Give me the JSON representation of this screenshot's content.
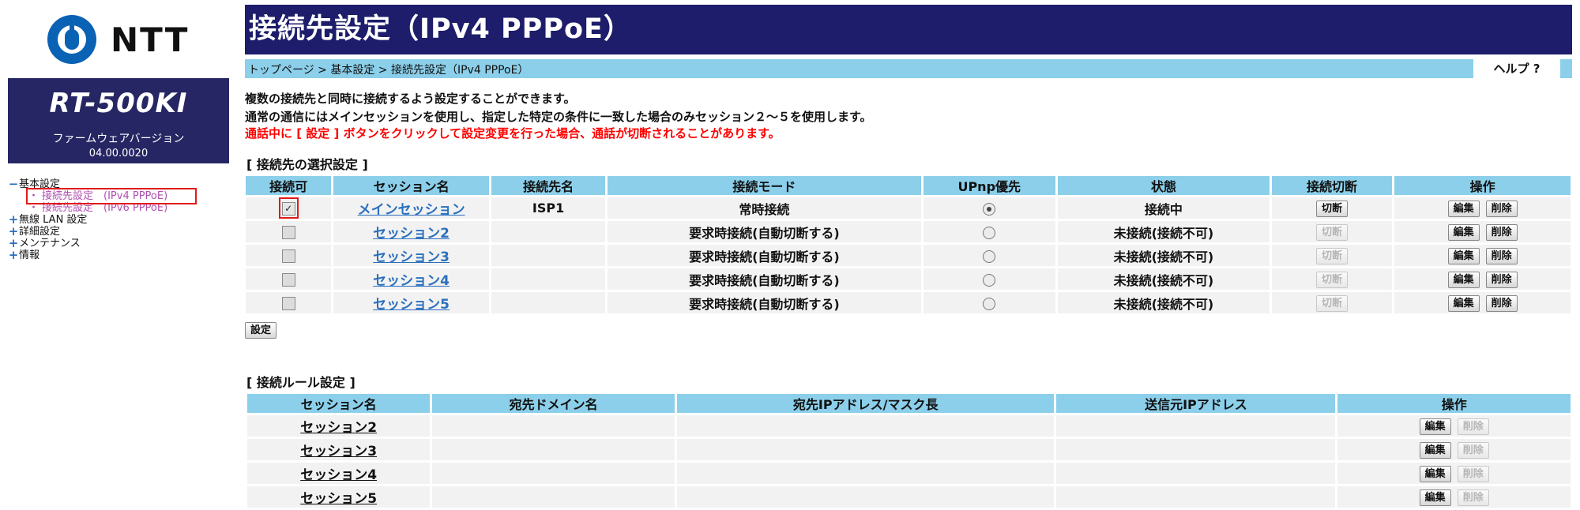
{
  "brand": {
    "logo_text": "NTT",
    "model": "RT-500KI",
    "fw_label": "ファームウェアバージョン",
    "fw_version": "04.00.0020"
  },
  "nav": {
    "basic": "基本設定",
    "sub_ipv4": "接続先設定　(IPv4 PPPoE)",
    "sub_ipv6": "接続先設定　(IPv6 PPPoE)",
    "wlan": "無線 LAN 設定",
    "detail": "詳細設定",
    "maint": "メンテナンス",
    "info": "情報"
  },
  "header": {
    "title": "接続先設定（IPv4 PPPoE）",
    "breadcrumb": "トップページ > 基本設定 > 接続先設定（IPv4 PPPoE）",
    "help": "ヘルプ ?"
  },
  "intro": {
    "line1": "複数の接続先と同時に接続するよう設定することができます。",
    "line2": "通常の通信にはメインセッションを使用し、指定した特定の条件に一致した場合のみセッション２～５を使用します。",
    "line3": "通話中に [ 設定 ] ボタンをクリックして設定変更を行った場合、通話が切断されることがあります。"
  },
  "sessions": {
    "label": "[ 接続先の選択設定 ]",
    "headers": [
      "接続可",
      "セッション名",
      "接続先名",
      "接続モード",
      "UPnp優先",
      "状態",
      "接続切断",
      "操作"
    ],
    "rows": [
      {
        "enabled": true,
        "name": "メインセッション",
        "dest": "ISP1",
        "mode": "常時接続",
        "upnp": true,
        "status": "接続中",
        "disconnect": "切断",
        "edit": "編集",
        "delete": "削除"
      },
      {
        "enabled": false,
        "name": "セッション2",
        "dest": "",
        "mode": "要求時接続(自動切断する)",
        "upnp": false,
        "status": "未接続(接続不可)",
        "disconnect": "切断",
        "edit": "編集",
        "delete": "削除"
      },
      {
        "enabled": false,
        "name": "セッション3",
        "dest": "",
        "mode": "要求時接続(自動切断する)",
        "upnp": false,
        "status": "未接続(接続不可)",
        "disconnect": "切断",
        "edit": "編集",
        "delete": "削除"
      },
      {
        "enabled": false,
        "name": "セッション4",
        "dest": "",
        "mode": "要求時接続(自動切断する)",
        "upnp": false,
        "status": "未接続(接続不可)",
        "disconnect": "切断",
        "edit": "編集",
        "delete": "削除"
      },
      {
        "enabled": false,
        "name": "セッション5",
        "dest": "",
        "mode": "要求時接続(自動切断する)",
        "upnp": false,
        "status": "未接続(接続不可)",
        "disconnect": "切断",
        "edit": "編集",
        "delete": "削除"
      }
    ],
    "apply": "設定"
  },
  "rules": {
    "label": "[ 接続ルール設定 ]",
    "headers": [
      "セッション名",
      "宛先ドメイン名",
      "宛先IPアドレス/マスク長",
      "送信元IPアドレス",
      "操作"
    ],
    "rows": [
      {
        "name": "セッション2",
        "domain": "",
        "dest_ip": "",
        "src_ip": "",
        "edit": "編集",
        "delete": "削除"
      },
      {
        "name": "セッション3",
        "domain": "",
        "dest_ip": "",
        "src_ip": "",
        "edit": "編集",
        "delete": "削除"
      },
      {
        "name": "セッション4",
        "domain": "",
        "dest_ip": "",
        "src_ip": "",
        "edit": "編集",
        "delete": "削除"
      },
      {
        "name": "セッション5",
        "domain": "",
        "dest_ip": "",
        "src_ip": "",
        "edit": "編集",
        "delete": "削除"
      }
    ]
  }
}
